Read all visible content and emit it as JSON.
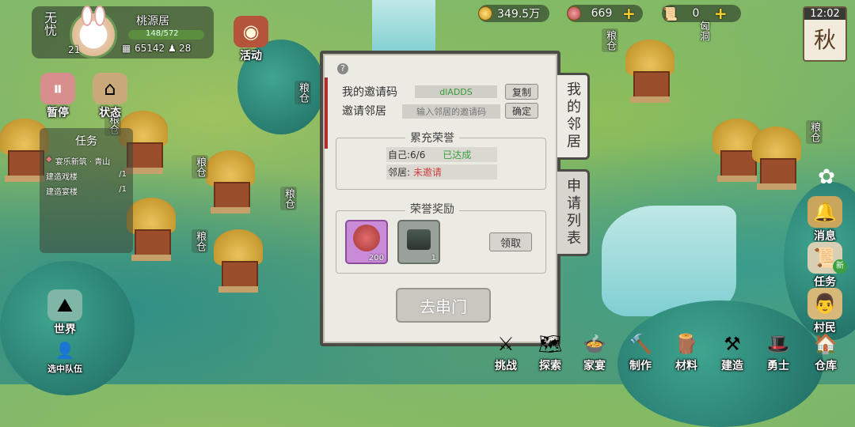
{
  "player": {
    "status": "无忧",
    "name": "桃源居",
    "level": "21",
    "exp": "148/572",
    "population": "65142",
    "villagers": "28"
  },
  "resources": {
    "coins": "349.5万",
    "gems": "669",
    "cave_count": "0",
    "cave_label": "匈洞"
  },
  "season": {
    "time": "12:02",
    "name": "秋"
  },
  "left_buttons": {
    "pause": "暂停",
    "status": "状态",
    "activity": "活动"
  },
  "task_panel": {
    "title": "任务",
    "quest": "宴乐新筑 · 青山",
    "items": [
      {
        "label": "建造戏楼",
        "count": "/1"
      },
      {
        "label": "建造宴楼",
        "count": "/1"
      }
    ]
  },
  "granary_label": "粮仓",
  "dialog": {
    "help": "?",
    "my_code_label": "我的邀请码",
    "my_code": "dlADDS",
    "copy_btn": "复制",
    "invite_label": "邀请邻居",
    "invite_placeholder": "输入邻居的邀请码",
    "confirm_btn": "确定",
    "honor_title": "累充荣誉",
    "self_label": "自己:6/6",
    "self_status": "已达成",
    "neighbor_label": "邻居:",
    "neighbor_status": "未邀请",
    "reward_title": "荣誉奖励",
    "reward1_count": "200",
    "reward2_count": "1",
    "claim_btn": "领取",
    "visit_btn": "去串门"
  },
  "side_tabs": {
    "neighbors": "我的邻居",
    "requests": "申请列表"
  },
  "right_buttons": {
    "messages": "消息",
    "tasks": "任务",
    "new_badge": "新",
    "villagers": "村民"
  },
  "bottom_left": {
    "world": "世界",
    "team": "选中队伍"
  },
  "bottom_bar": [
    "挑战",
    "探索",
    "家宴",
    "制作",
    "材料",
    "建造",
    "勇士",
    "仓库"
  ],
  "colors": {
    "accent": "#5b8f3e",
    "gold": "#ffd42a",
    "achieved": "#3aa040",
    "not_invited": "#d04040"
  }
}
